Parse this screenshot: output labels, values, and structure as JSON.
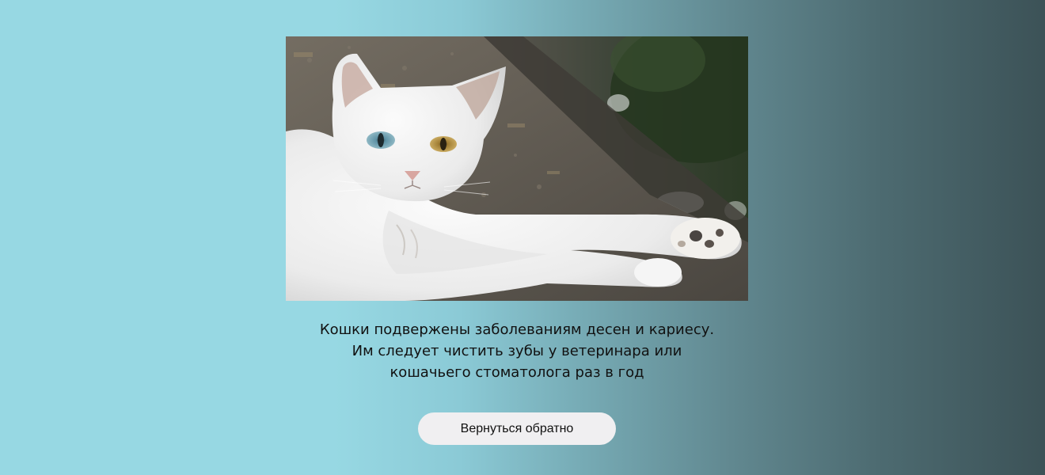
{
  "photo": {
    "subject": "white-cat-heterochromia",
    "colors": {
      "fur": "#f2f2f2",
      "left_eye": "#6a98a8",
      "right_eye": "#a8853a",
      "ledge": "#6b655b",
      "foliage": "#2f4428"
    }
  },
  "caption": {
    "line1": "Кошки подвержены заболеваниям десен и кариесу.",
    "line2": "Им следует чистить зубы у ветеринара или",
    "line3": "кошачьего стоматолога раз в год"
  },
  "back_button": {
    "label": "Вернуться обратно"
  },
  "colors": {
    "background_left": "#97d8e3",
    "background_right": "#3c5257",
    "button_bg": "#f0eff1",
    "text": "#111111"
  }
}
